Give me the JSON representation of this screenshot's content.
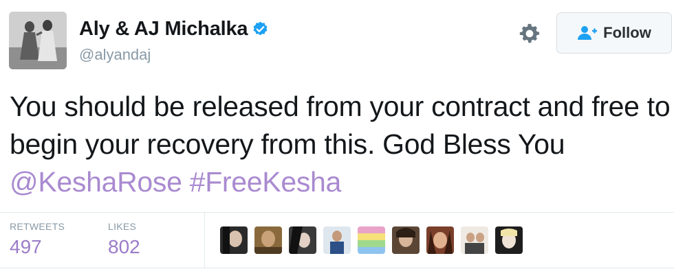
{
  "tweet": {
    "author_name": "Aly & AJ Michalka",
    "handle": "@alyandaj",
    "text_plain": "You should be released from your contract and free to begin your recovery from this. God Bless You ",
    "mention": "@KeshaRose",
    "hashtag": "#FreeKesha"
  },
  "actions": {
    "follow_label": "Follow",
    "settings_icon": "gear-icon",
    "follow_icon": "add-user-icon"
  },
  "stats": {
    "retweets_label": "RETWEETS",
    "retweets_value": "497",
    "likes_label": "LIKES",
    "likes_value": "802"
  },
  "colors": {
    "link": "#a98ad0",
    "stat_value": "#9b7cc8",
    "verified": "#1da1f2"
  }
}
